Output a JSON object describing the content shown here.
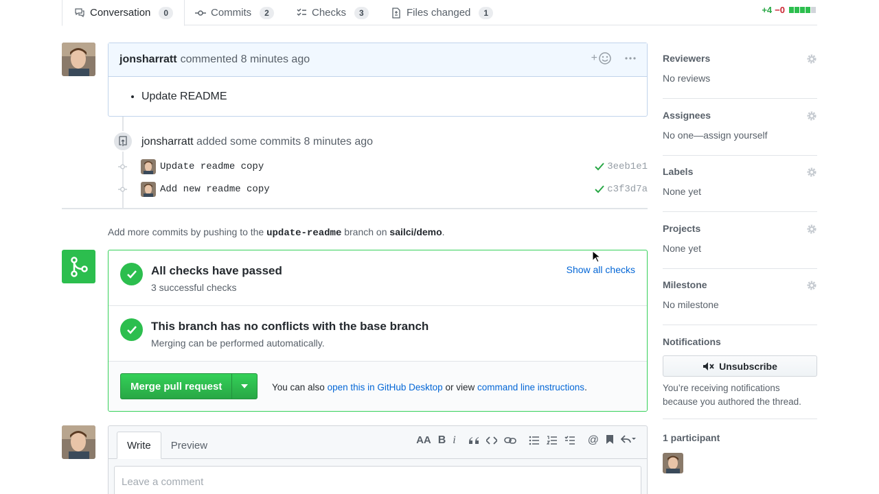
{
  "tabs": [
    {
      "label": "Conversation",
      "count": "0",
      "icon": "comment-discussion-icon"
    },
    {
      "label": "Commits",
      "count": "2",
      "icon": "git-commit-icon"
    },
    {
      "label": "Checks",
      "count": "3",
      "icon": "checklist-icon"
    },
    {
      "label": "Files changed",
      "count": "1",
      "icon": "file-diff-icon"
    }
  ],
  "diffstat": {
    "additions": "+4",
    "deletions": "−0"
  },
  "comment": {
    "author": "jonsharratt",
    "action": "commented 8 minutes ago",
    "add_reaction": "+",
    "body_items": [
      "Update README"
    ]
  },
  "timeline": {
    "author": "jonsharratt",
    "action": "added some commits 8 minutes ago",
    "commits": [
      {
        "message": "Update readme copy",
        "sha": "3eeb1e1"
      },
      {
        "message": "Add new readme copy",
        "sha": "c3f3d7a"
      }
    ]
  },
  "push_hint": {
    "prefix": "Add more commits by pushing to the",
    "branch": "update-readme",
    "mid": "branch on",
    "repo": "sailci/demo",
    "suffix": "."
  },
  "merge_box": {
    "checks_title": "All checks have passed",
    "checks_sub": "3 successful checks",
    "show_all": "Show all checks",
    "conflict_title": "This branch has no conflicts with the base branch",
    "conflict_sub": "Merging can be performed automatically.",
    "merge_button": "Merge pull request",
    "alt_prefix": "You can also",
    "alt_link1": "open this in GitHub Desktop",
    "alt_mid": "or view",
    "alt_link2": "command line instructions",
    "alt_suffix": "."
  },
  "write": {
    "tab_write": "Write",
    "tab_preview": "Preview",
    "placeholder": "Leave a comment",
    "toolbar_header": "AA",
    "toolbar_bold": "B",
    "toolbar_italic": "i",
    "toolbar_mention": "@"
  },
  "sidebar": {
    "reviewers": {
      "title": "Reviewers",
      "value": "No reviews"
    },
    "assignees": {
      "title": "Assignees",
      "value": "No one—assign yourself"
    },
    "labels": {
      "title": "Labels",
      "value": "None yet"
    },
    "projects": {
      "title": "Projects",
      "value": "None yet"
    },
    "milestone": {
      "title": "Milestone",
      "value": "No milestone"
    },
    "notifications": {
      "title": "Notifications",
      "button": "Unsubscribe",
      "note": "You’re receiving notifications because you authored the thread."
    },
    "participants": {
      "title": "1 participant"
    }
  },
  "colors": {
    "green": "#2cbe4e",
    "link": "#0366d6",
    "border_blue": "#c0d3eb"
  }
}
